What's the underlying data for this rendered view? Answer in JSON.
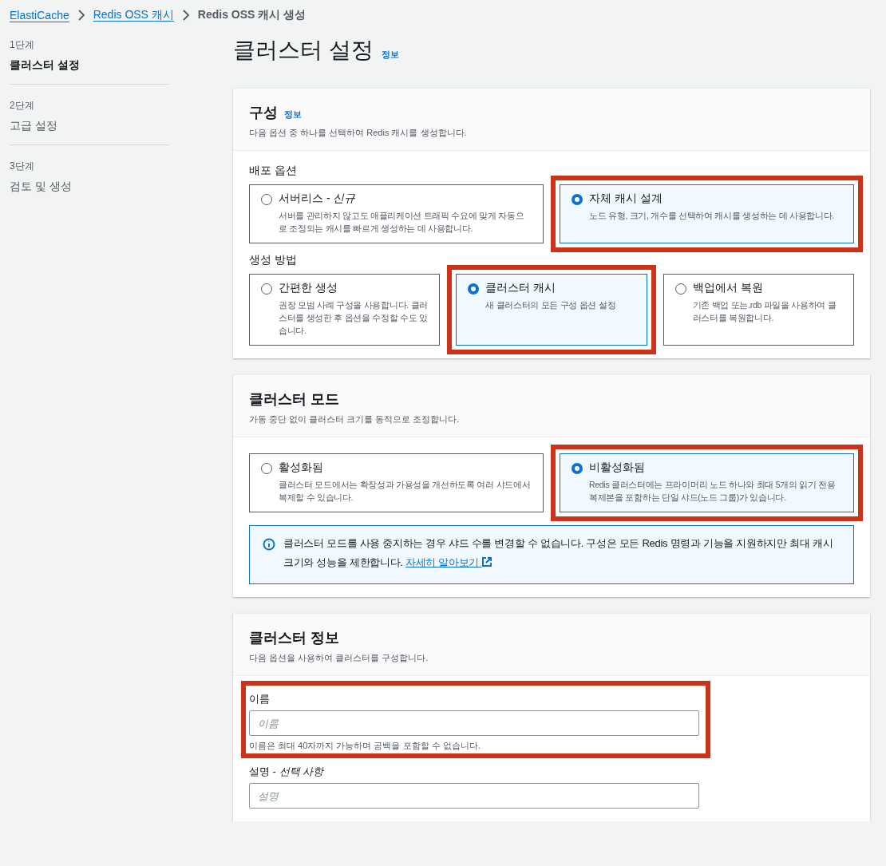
{
  "breadcrumbs": [
    {
      "label": "ElastiCache",
      "link": true
    },
    {
      "label": "Redis OSS 캐시",
      "link": true
    },
    {
      "label": "Redis OSS 캐시 생성",
      "link": false
    }
  ],
  "steps": [
    {
      "step": "1단계",
      "title": "클러스터 설정",
      "selected": true
    },
    {
      "step": "2단계",
      "title": "고급 설정",
      "selected": false
    },
    {
      "step": "3단계",
      "title": "검토 및 생성",
      "selected": false
    }
  ],
  "page_title": "클러스터 설정",
  "page_info": "정보",
  "configuration": {
    "title": "구성",
    "info": "정보",
    "description": "다음 옵션 중 하나를 선택하여 Redis 캐시를 생성합니다.",
    "groups": [
      {
        "label": "배포 옵션",
        "options": [
          {
            "label": "서버리스 - *신규*",
            "description": "서버를 관리하지 않고도 애플리케이션 트래픽 수요에 맞게 자동으로 조정되는 캐시를 빠르게 생성하는 데 사용합니다.",
            "selected": false,
            "highlighted": false
          },
          {
            "label": "자체 캐시 설계",
            "description": "노드 유형, 크기, 개수를 선택하여 캐시를 생성하는 데 사용합니다.",
            "selected": true,
            "highlighted": true
          }
        ]
      },
      {
        "label": "생성 방법",
        "options": [
          {
            "label": "간편한 생성",
            "description": "권장 모범 사례 구성을 사용합니다. 클러스터를 생성한 후 옵션을 수정할 수도 있습니다.",
            "selected": false,
            "highlighted": false
          },
          {
            "label": "클러스터 캐시",
            "description": "새 클러스터의 모든 구성 옵션 설정",
            "selected": true,
            "highlighted": true
          },
          {
            "label": "백업에서 복원",
            "description": "기존 백업 또는.rdb 파일을 사용하여 클러스터를 복원합니다.",
            "selected": false,
            "highlighted": false
          }
        ]
      }
    ]
  },
  "cluster_mode": {
    "title": "클러스터 모드",
    "description": "가동 중단 없이 클러스터 크기를 동적으로 조정합니다.",
    "options": [
      {
        "label": "활성화됨",
        "description": "클러스터 모드에서는 확장성과 가용성을 개선하도록 여러 샤드에서 복제할 수 있습니다.",
        "selected": false,
        "highlighted": false
      },
      {
        "label": "비활성화됨",
        "description": "Redis 클러스터에는 프라이머리 노드 하나와 최대 5개의 읽기 전용 복제본을 포함하는 단일 샤드(노드 그룹)가 있습니다.",
        "selected": true,
        "highlighted": true
      }
    ],
    "alert": {
      "text": "클러스터 모드를 사용 중지하는 경우 샤드 수를 변경할 수 없습니다. 구성은 모든 Redis 명령과 기능을 지원하지만 최대 캐시 크기와 성능을 제한합니다.",
      "link": "자세히 알아보기"
    }
  },
  "cluster_info": {
    "title": "클러스터 정보",
    "description": "다음 옵션을 사용하여 클러스터를 구성합니다.",
    "fields": [
      {
        "label": "이름",
        "placeholder": "이름",
        "hint": "이름은 최대 40자까지 가능하며 공백을 포함할 수 없습니다.",
        "highlighted": true
      },
      {
        "label": "설명 - *선택 사항*",
        "placeholder": "설명",
        "highlighted": false
      }
    ]
  }
}
